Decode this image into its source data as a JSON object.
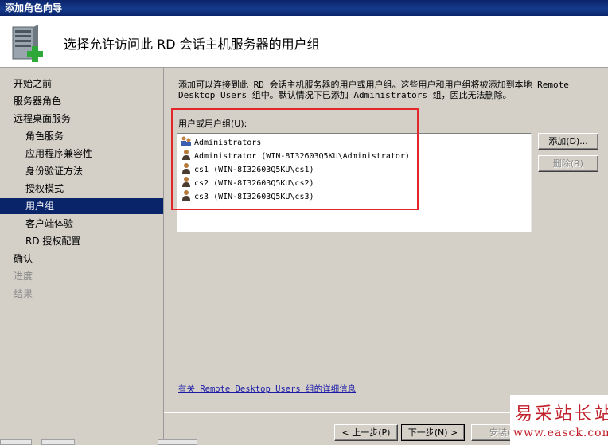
{
  "window": {
    "title": "添加角色向导"
  },
  "header": {
    "title": "选择允许访问此 RD 会话主机服务器的用户组",
    "icon": "server-add-role-icon"
  },
  "sidebar": {
    "items": [
      {
        "label": "开始之前",
        "state": "normal",
        "level": 0
      },
      {
        "label": "服务器角色",
        "state": "normal",
        "level": 0
      },
      {
        "label": "远程桌面服务",
        "state": "normal",
        "level": 0
      },
      {
        "label": "角色服务",
        "state": "normal",
        "level": 1
      },
      {
        "label": "应用程序兼容性",
        "state": "normal",
        "level": 1
      },
      {
        "label": "身份验证方法",
        "state": "normal",
        "level": 1
      },
      {
        "label": "授权模式",
        "state": "normal",
        "level": 1
      },
      {
        "label": "用户组",
        "state": "active",
        "level": 1
      },
      {
        "label": "客户端体验",
        "state": "normal",
        "level": 1
      },
      {
        "label": "RD 授权配置",
        "state": "normal",
        "level": 1
      },
      {
        "label": "确认",
        "state": "normal",
        "level": 0
      },
      {
        "label": "进度",
        "state": "disabled",
        "level": 0
      },
      {
        "label": "结果",
        "state": "disabled",
        "level": 0
      }
    ]
  },
  "main": {
    "description": "添加可以连接到此 RD 会话主机服务器的用户或用户组。这些用户和用户组将被添加到本地 Remote\nDesktop Users 组中。默认情况下已添加 Administrators 组，因此无法删除。",
    "list_label": "用户或用户组(U):",
    "entries": [
      {
        "text": "Administrators",
        "icon": "group-icon"
      },
      {
        "text": "Administrator (WIN-8I32603Q5KU\\Administrator)",
        "icon": "user-icon"
      },
      {
        "text": "cs1 (WIN-8I32603Q5KU\\cs1)",
        "icon": "user-icon"
      },
      {
        "text": "cs2 (WIN-8I32603Q5KU\\cs2)",
        "icon": "user-icon"
      },
      {
        "text": "cs3 (WIN-8I32603Q5KU\\cs3)",
        "icon": "user-icon"
      }
    ],
    "add_button": "添加(D)...",
    "remove_button": "删除(R)",
    "info_link": "有关 Remote Desktop Users 组的详细信息"
  },
  "footer": {
    "prev_button": "< 上一步(P)",
    "next_button": "下一步(N) >",
    "install_button": "安装(I)"
  },
  "watermark": {
    "text": "易采站长站",
    "url": "www.easck.com"
  },
  "colors": {
    "accent": "#0a246a",
    "highlight_box": "#e2262a",
    "link": "#1a1aa6",
    "watermark": "#c0202a"
  }
}
